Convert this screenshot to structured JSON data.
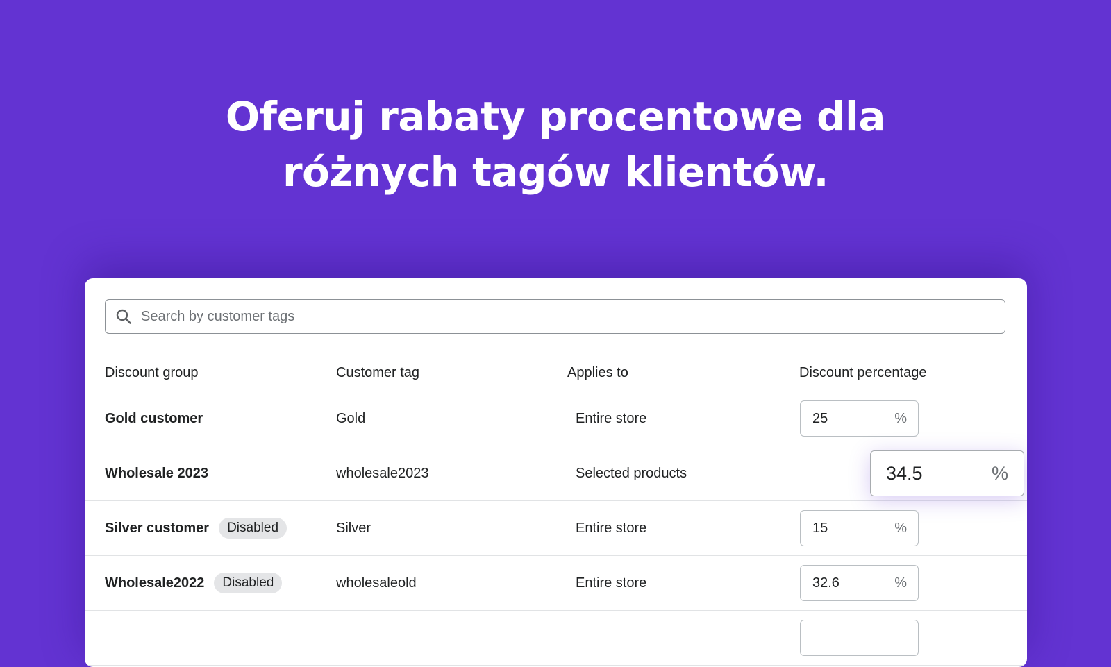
{
  "headline": {
    "line1": "Oferuj rabaty procentowe dla",
    "line2": "różnych tagów klientów."
  },
  "search": {
    "placeholder": "Search by customer tags",
    "value": ""
  },
  "table": {
    "columns": [
      "Discount group",
      "Customer tag",
      "Applies to",
      "Discount percentage"
    ],
    "rows": [
      {
        "group": "Gold customer",
        "badge": "",
        "tag": "Gold",
        "applies_to": "Entire store",
        "percentage": "25",
        "unit": "%"
      },
      {
        "group": "Wholesale 2023",
        "badge": "",
        "tag": "wholesale2023",
        "applies_to": "Selected products",
        "percentage": "34.5",
        "unit": "%"
      },
      {
        "group": "Silver customer",
        "badge": "Disabled",
        "tag": "Silver",
        "applies_to": "Entire store",
        "percentage": "15",
        "unit": "%"
      },
      {
        "group": "Wholesale2022",
        "badge": "Disabled",
        "tag": "wholesaleold",
        "applies_to": "Entire store",
        "percentage": "32.6",
        "unit": "%"
      }
    ]
  },
  "colors": {
    "background": "#6333d2",
    "card": "#ffffff",
    "badge": "#e4e5e7"
  }
}
